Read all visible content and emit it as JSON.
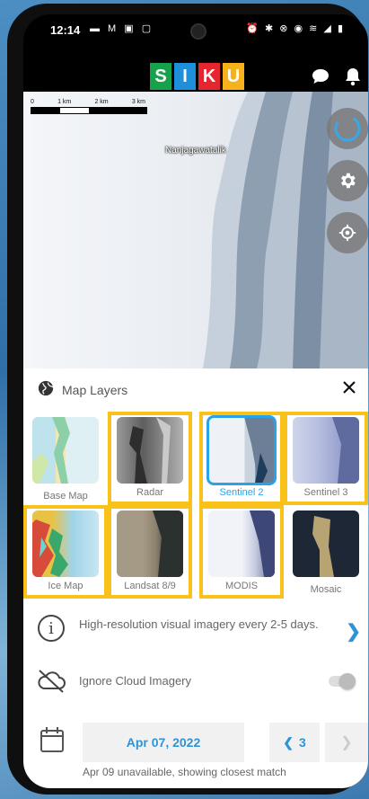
{
  "status": {
    "time": "12:14",
    "left_icons": "▬ M ▣ ▢",
    "right_icons": "⏰ ✱ ⊗ ◉ ≋ ◢ ▮"
  },
  "logo": {
    "letters": [
      "S",
      "I",
      "K",
      "U"
    ],
    "colors": [
      "#15a24a",
      "#1f8fd9",
      "#e5262e",
      "#f7b21b"
    ]
  },
  "map": {
    "scale_labels": [
      "0",
      "1 km",
      "2 km",
      "3 km"
    ],
    "place_name": "Nanjagawatalik"
  },
  "layers_panel": {
    "title": "Map Layers",
    "layers": [
      {
        "label": "Base Map",
        "highlighted": false,
        "selected": false
      },
      {
        "label": "Radar",
        "highlighted": true,
        "selected": false
      },
      {
        "label": "Sentinel 2",
        "highlighted": true,
        "selected": true
      },
      {
        "label": "Sentinel 3",
        "highlighted": true,
        "selected": false
      },
      {
        "label": "Ice Map",
        "highlighted": true,
        "selected": false
      },
      {
        "label": "Landsat 8/9",
        "highlighted": true,
        "selected": false
      },
      {
        "label": "MODIS",
        "highlighted": true,
        "selected": false
      },
      {
        "label": "Mosaic",
        "highlighted": false,
        "selected": false
      }
    ],
    "info_text": "High-resolution visual imagery every 2-5 days.",
    "cloud_label": "Ignore Cloud Imagery",
    "date": "Apr 07, 2022",
    "prev_count": "3",
    "note": "Apr 09 unavailable, showing closest match"
  },
  "colors": {
    "accent": "#2f94d6",
    "highlight": "#f8c21a",
    "selected_border": "#29a3e6"
  },
  "icons": {
    "chat": "chat-icon",
    "bell": "bell-icon",
    "refresh": "refresh-icon",
    "settings": "gear-icon",
    "locate": "gps-icon",
    "globe": "globe-icon",
    "close": "close-icon",
    "info": "info-icon",
    "cloud_off": "cloud-off-icon",
    "calendar": "calendar-icon"
  }
}
